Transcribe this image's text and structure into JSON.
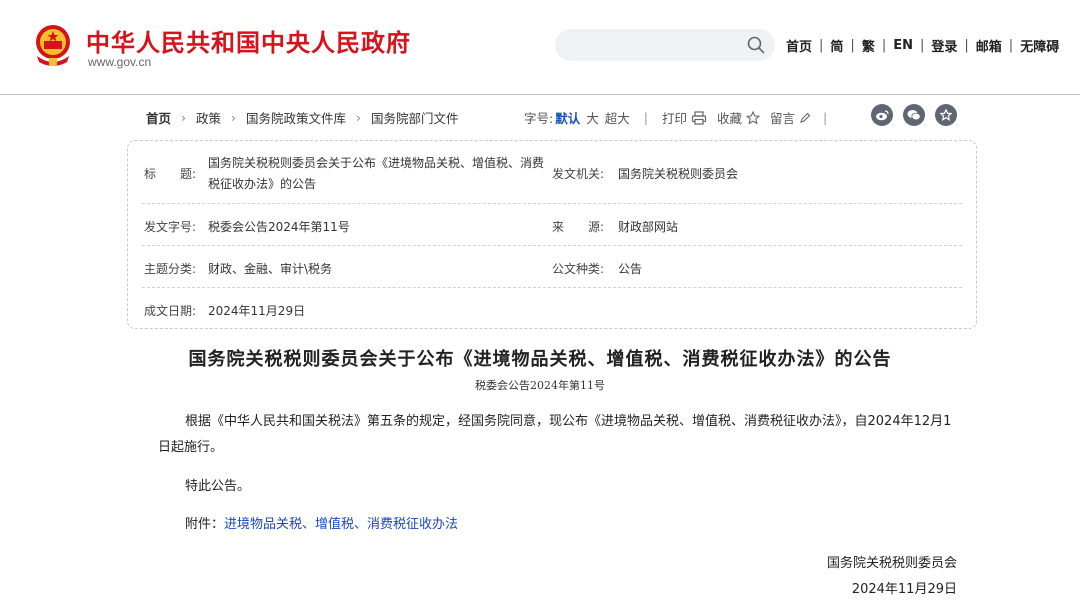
{
  "header": {
    "site_title": "中华人民共和国中央人民政府",
    "site_url": "www.gov.cn",
    "search_placeholder": "",
    "nav": [
      "首页",
      "简",
      "繁",
      "EN",
      "登录",
      "邮箱",
      "无障碍"
    ]
  },
  "breadcrumb": [
    "首页",
    "政策",
    "国务院政策文件库",
    "国务院部门文件"
  ],
  "tools": {
    "font_label": "字号:",
    "font_default": "默认",
    "font_large": "大",
    "font_xlarge": "超大",
    "print": "打印",
    "favorite": "收藏",
    "comment": "留言"
  },
  "info": {
    "title_label": "标　　题:",
    "title_value_line1": "国务院关税税则委员会关于公布《进境物品关税、增值税、消费",
    "title_value_line2": "税征收办法》的公告",
    "issuer_label": "发文机关:",
    "issuer_value": "国务院关税税则委员会",
    "docno_label": "发文字号:",
    "docno_value": "税委会公告2024年第11号",
    "source_label": "来　　源:",
    "source_value": "财政部网站",
    "topic_label": "主题分类:",
    "topic_value": "财政、金融、审计\\税务",
    "type_label": "公文种类:",
    "type_value": "公告",
    "date_label": "成文日期:",
    "date_value": "2024年11月29日"
  },
  "article": {
    "title": "国务院关税税则委员会关于公布《进境物品关税、增值税、消费税征收办法》的公告",
    "doc_number": "税委会公告2024年第11号",
    "para1": "根据《中华人民共和国关税法》第五条的规定，经国务院同意，现公布《进境物品关税、增值税、消费税征收办法》，自2024年12月1日起施行。",
    "para2": "特此公告。",
    "attachment_label": "附件：",
    "attachment_link": "进境物品关税、增值税、消费税征收办法",
    "signature": "国务院关税税则委员会",
    "sign_date": "2024年11月29日"
  },
  "colors": {
    "brand_red": "#d6121b",
    "link_blue": "#1a47c7",
    "share_gray": "#5e6573"
  }
}
